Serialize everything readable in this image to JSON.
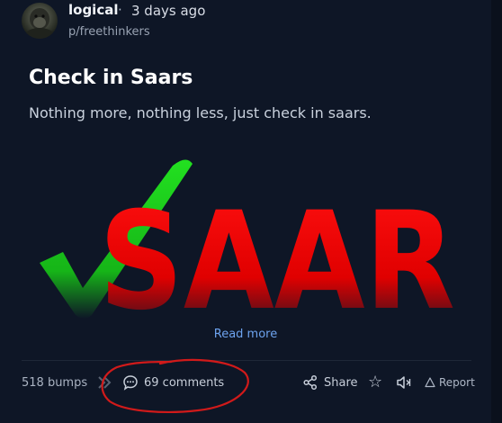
{
  "post": {
    "author": "logical",
    "separator": "·",
    "time": "3 days ago",
    "community": "p/freethinkers",
    "title": "Check in Saars",
    "body": "Nothing more, nothing less, just check in saars.",
    "image_text": "SAAR",
    "read_more": "Read more"
  },
  "actions": {
    "bumps": "518 bumps",
    "comments": "69 comments",
    "share": "Share",
    "report": "Report"
  },
  "icons": {
    "avatar": "gorilla-avatar",
    "bump": "bump-icon",
    "comment": "comment-icon",
    "share": "share-icon",
    "star": "star-icon",
    "speaker": "speaker-icon",
    "report": "warning-triangle-icon"
  },
  "colors": {
    "background": "#0e1626",
    "link": "#6da3ef",
    "image_red": "#ff0a0a",
    "image_green": "#16d21a",
    "annotation": "#d11a1a"
  }
}
